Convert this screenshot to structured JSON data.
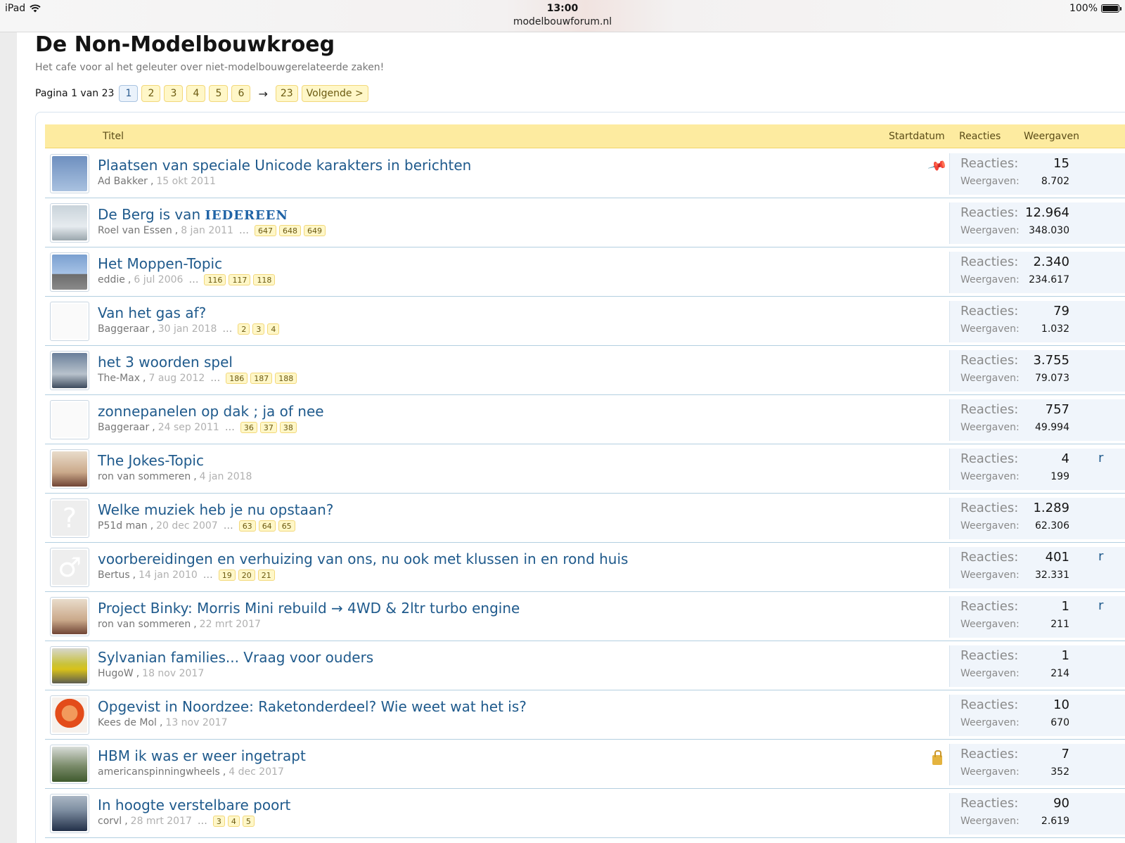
{
  "statusbar": {
    "device": "iPad",
    "time": "13:00",
    "url": "modelbouwforum.nl",
    "battery": "100%"
  },
  "forum": {
    "title": "De Non-Modelbouwkroeg",
    "description": "Het cafe voor al het geleuter over niet-modelbouwgerelateerde zaken!"
  },
  "pagination": {
    "label": "Pagina 1 van 23",
    "pages": [
      "1",
      "2",
      "3",
      "4",
      "5",
      "6"
    ],
    "current": "1",
    "arrow": "→",
    "last": "23",
    "next": "Volgende >"
  },
  "list_header": {
    "title": "Titel",
    "start_date": "Startdatum",
    "replies": "Reacties",
    "views": "Weergaven"
  },
  "stat_labels": {
    "replies": "Reacties:",
    "views": "Weergaven:"
  },
  "threads": [
    {
      "title": "Plaatsen van speciale Unicode karakters in berichten",
      "author": "Ad Bakker",
      "date": "15 okt 2011",
      "pages": [],
      "replies": "15",
      "views": "8.702",
      "icon": "pin-icon",
      "avatar": "seagull",
      "edge": ""
    },
    {
      "title": "De Berg is van ",
      "title_styled": "IEDEREEN",
      "author": "Roel van Essen",
      "date": "8 jan 2011",
      "pages": [
        "647",
        "648",
        "649"
      ],
      "replies": "12.964",
      "views": "348.030",
      "icon": "",
      "avatar": "plane",
      "edge": ""
    },
    {
      "title": "Het Moppen-Topic",
      "author": "eddie",
      "date": "6 jul 2006",
      "pages": [
        "116",
        "117",
        "118"
      ],
      "replies": "2.340",
      "views": "234.617",
      "icon": "",
      "avatar": "helicopter",
      "edge": ""
    },
    {
      "title": "Van het gas af?",
      "author": "Baggeraar",
      "date": "30 jan 2018",
      "pages": [
        "2",
        "3",
        "4"
      ],
      "replies": "79",
      "views": "1.032",
      "icon": "",
      "avatar": "ship-sketch",
      "edge": ""
    },
    {
      "title": "het 3 woorden spel",
      "author": "The-Max",
      "date": "7 aug 2012",
      "pages": [
        "186",
        "187",
        "188"
      ],
      "replies": "3.755",
      "views": "79.073",
      "icon": "",
      "avatar": "pilot",
      "edge": ""
    },
    {
      "title": "zonnepanelen op dak ; ja of nee",
      "author": "Baggeraar",
      "date": "24 sep 2011",
      "pages": [
        "36",
        "37",
        "38"
      ],
      "replies": "757",
      "views": "49.994",
      "icon": "",
      "avatar": "ship-sketch",
      "edge": ""
    },
    {
      "title": "The Jokes-Topic",
      "author": "ron van sommeren",
      "date": "4 jan 2018",
      "pages": [],
      "replies": "4",
      "views": "199",
      "icon": "",
      "avatar": "man",
      "edge": "r"
    },
    {
      "title": "Welke muziek heb je nu opstaan?",
      "author": "P51d man",
      "date": "20 dec 2007",
      "pages": [
        "63",
        "64",
        "65"
      ],
      "replies": "1.289",
      "views": "62.306",
      "icon": "",
      "avatar": "question",
      "edge": ""
    },
    {
      "title": "voorbereidingen en verhuizing van ons, nu ook met klussen in en rond huis",
      "author": "Bertus",
      "date": "14 jan 2010",
      "pages": [
        "19",
        "20",
        "21"
      ],
      "replies": "401",
      "views": "32.331",
      "icon": "",
      "avatar": "male",
      "edge": "r"
    },
    {
      "title": "Project Binky: Morris Mini rebuild → 4WD & 2ltr turbo engine",
      "author": "ron van sommeren",
      "date": "22 mrt 2017",
      "pages": [],
      "replies": "1",
      "views": "211",
      "icon": "",
      "avatar": "man",
      "edge": "r"
    },
    {
      "title": "Sylvanian families... Vraag voor ouders",
      "author": "HugoW",
      "date": "18 nov 2017",
      "pages": [],
      "replies": "1",
      "views": "214",
      "icon": "",
      "avatar": "car",
      "edge": ""
    },
    {
      "title": "Opgevist in Noordzee: Raketonderdeel? Wie weet wat het is?",
      "author": "Kees de Mol",
      "date": "13 nov 2017",
      "pages": [],
      "replies": "10",
      "views": "670",
      "icon": "",
      "avatar": "muppet",
      "edge": ""
    },
    {
      "title": "HBM ik was er weer ingetrapt",
      "author": "americanspinningwheels",
      "date": "4 dec 2017",
      "pages": [],
      "replies": "7",
      "views": "352",
      "icon": "lock-icon",
      "avatar": "sign",
      "edge": ""
    },
    {
      "title": "In hoogte verstelbare poort",
      "author": "corvl",
      "date": "28 mrt 2017",
      "pages": [
        "3",
        "4",
        "5"
      ],
      "replies": "90",
      "views": "2.619",
      "icon": "",
      "avatar": "suit",
      "edge": ""
    }
  ]
}
